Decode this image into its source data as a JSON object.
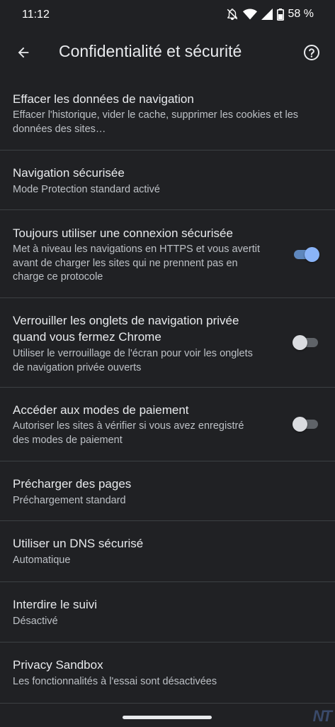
{
  "status_bar": {
    "time": "11:12",
    "battery": "58 %",
    "icons": [
      "notifications-off-icon",
      "wifi-icon",
      "cell-signal-icon",
      "battery-icon"
    ]
  },
  "app_bar": {
    "title": "Confidentialité et sécurité",
    "back_icon": "arrow-back-icon",
    "help_icon": "help-circle-icon"
  },
  "settings": [
    {
      "title": "Effacer les données de navigation",
      "subtitle": "Effacer l'historique, vider le cache, supprimer les cookies et les données des sites…"
    },
    {
      "title": "Navigation sécurisée",
      "subtitle": "Mode Protection standard activé"
    },
    {
      "title": "Toujours utiliser une connexion sécurisée",
      "subtitle": "Met à niveau les navigations en HTTPS et vous avertit avant de charger les sites qui ne prennent pas en charge ce protocole",
      "toggle": true
    },
    {
      "title": "Verrouiller les onglets de navigation privée quand vous fermez Chrome",
      "subtitle": "Utiliser le verrouillage de l'écran pour voir les onglets de navigation privée ouverts",
      "toggle": false
    },
    {
      "title": "Accéder aux modes de paiement",
      "subtitle": "Autoriser les sites à vérifier si vous avez enregistré des modes de paiement",
      "toggle": false
    },
    {
      "title": "Précharger des pages",
      "subtitle": "Préchargement standard"
    },
    {
      "title": "Utiliser un DNS sécurisé",
      "subtitle": "Automatique"
    },
    {
      "title": "Interdire le suivi",
      "subtitle": "Désactivé"
    },
    {
      "title": "Privacy Sandbox",
      "subtitle": "Les fonctionnalités à l'essai sont désactivées"
    }
  ],
  "watermark": "NT",
  "colors": {
    "background": "#202124",
    "divider": "#3c4043",
    "toggle_on_thumb": "#8ab4f8",
    "toggle_on_track": "#5e87bd",
    "toggle_off_thumb": "#dadce0",
    "toggle_off_track": "#5f6368"
  }
}
